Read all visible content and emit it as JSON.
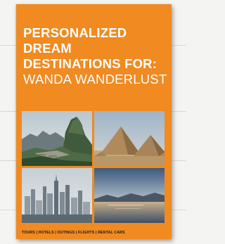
{
  "brochure": {
    "headline_lines": [
      "PERSONALIZED",
      "DREAM",
      "DESTINATIONS FOR:"
    ],
    "recipient": "WANDA WANDERLUST",
    "footer": "TOURS | HOTELS | OUTINGS | FLIGHTS | RENTAL CARS",
    "accent_color": "#f08a21",
    "photos": [
      {
        "subject": "mountain ruins"
      },
      {
        "subject": "desert pyramids"
      },
      {
        "subject": "city skyline"
      },
      {
        "subject": "sunset lake"
      }
    ]
  }
}
